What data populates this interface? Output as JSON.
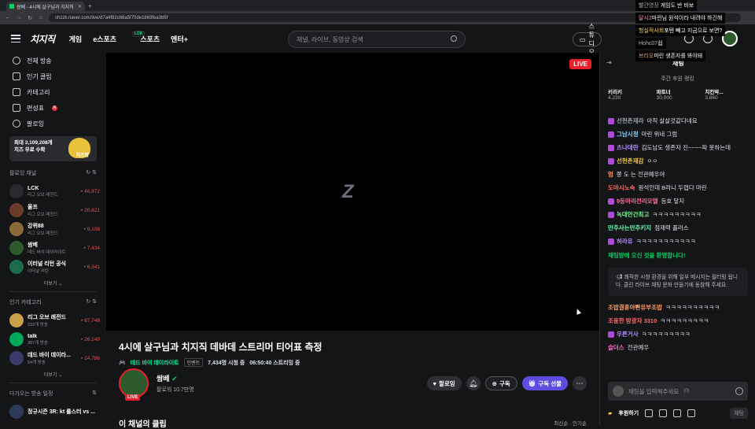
{
  "browser": {
    "tab_title": "쌈베 - 4시에 살구님과 치지직",
    "new_tab": "+",
    "url": "chzzk.naver.com/live/d7a4f82c66a5f70de1869fea3b5f"
  },
  "header": {
    "logo": "치지직",
    "nav": [
      "게임",
      "e스포츠",
      "스포츠",
      "엔터+"
    ],
    "lck_badge": "LCK",
    "search_placeholder": "채널, 라이브, 동영상 검색",
    "studio": "스튜디오"
  },
  "sidebar": {
    "menu": [
      {
        "label": "전체 방송",
        "icon": "broadcast-icon"
      },
      {
        "label": "인기 클립",
        "icon": "scissors-icon"
      },
      {
        "label": "카테고리",
        "icon": "grid-icon"
      },
      {
        "label": "편성표",
        "icon": "calendar-icon",
        "new": "N"
      },
      {
        "label": "팔로잉",
        "icon": "heart-icon"
      }
    ],
    "promo": {
      "line1": "최대 3,109,208개",
      "line2": "치즈 무료 수확",
      "tag": "치즈팜"
    },
    "following_header": "팔로잉 채널",
    "following": [
      {
        "name": "LCK",
        "sub": "리그 오브 레전드",
        "count": "46,972",
        "color": "#2a2b2f"
      },
      {
        "name": "울프",
        "sub": "리그 오브 레전드",
        "count": "20,621",
        "color": "#6b3b2a"
      },
      {
        "name": "강퀴88",
        "sub": "리그 오브 레전드",
        "count": "9,108",
        "color": "#8a6a3a"
      },
      {
        "name": "쌈베",
        "sub": "데드 바이 데이라이트",
        "count": "7,434",
        "color": "#2c5a2c"
      },
      {
        "name": "이터널 리턴 공식",
        "sub": "이터널 리턴",
        "count": "6,341",
        "color": "#1c6b4a"
      }
    ],
    "more": "더보기",
    "popular_header": "인기 카테고리",
    "popular": [
      {
        "name": "리그 오브 레전드",
        "sub": "232개 방송",
        "count": "87,748",
        "color": "#c8a14a"
      },
      {
        "name": "talk",
        "sub": "387개 방송",
        "count": "26,149",
        "color": "#00a85a"
      },
      {
        "name": "데드 바이 데이라...",
        "sub": "54개 방송",
        "count": "24,786",
        "color": "#3a3a6b"
      }
    ],
    "more2": "더보기",
    "upcoming_header": "다가오는 방송 일정",
    "upcoming": {
      "name": "정규시즌 3R: kt 롤스터 vs ..."
    }
  },
  "player": {
    "live": "LIVE",
    "logo": "Z"
  },
  "stream": {
    "title": "4시에 살구님과 치지직 데바데 스트리머 티어표 측정",
    "category": "데드 바이 데이라이트",
    "tag": "인벤트",
    "viewers": "7,434명 시청 중",
    "uptime": "06:50:40 스트리밍 중",
    "streamer": "쌈베",
    "followers": "팔로워 10.7만명",
    "live": "LIVE",
    "follow": "팔로잉",
    "subscribe": "구독",
    "gift": "구독 선물",
    "clips": "이 채널의 클립",
    "sort": "최신순 · 인기순"
  },
  "chat": {
    "title": "채팅",
    "ranking_head": "주간 후원 랭킹",
    "ranking": [
      {
        "name": "키리키",
        "val": "4,230"
      },
      {
        "name": "파트너",
        "val": "30,000"
      },
      {
        "name": "치킨막...",
        "val": "3,860"
      }
    ],
    "messages": [
      {
        "nick": "선헌존재라",
        "text": "아직 살살것같다네요",
        "color": "#9ca0a8",
        "badge": true
      },
      {
        "nick": "그남시정",
        "text": "마린 위네 그럼",
        "color": "#8fd3ff",
        "badge": true
      },
      {
        "nick": "츠나데란",
        "text": "김도남도 생존자 진~~~~파 못하는데",
        "color": "#b58cff",
        "badge": true
      },
      {
        "nick": "선헌존재감",
        "text": "ㅇㅇ",
        "color": "#f2c94c",
        "badge": true
      },
      {
        "nick": "엄",
        "text": "쫑 도 는 전관예우야",
        "color": "#ff9f6b",
        "badge": false
      },
      {
        "nick": "도마시노속",
        "text": "원석인데 B라니 두렵다 마린",
        "color": "#ff6b6b",
        "badge": false
      },
      {
        "nick": "9등마리전리모델",
        "text": "등호 닿지",
        "color": "#ff6b9f",
        "badge": true
      },
      {
        "nick": "녹대안간최고",
        "text": "ㅋㅋㅋㅋㅋㅋㅋㅋㅋ",
        "color": "#6bff8f",
        "badge": true
      },
      {
        "nick": "만주사는만주키지",
        "text": "점재력 플러스",
        "color": "#6bffb8",
        "badge": false
      },
      {
        "nick": "허라유",
        "text": "ㅋㅋㅋㅋㅋㅋㅋㅋㅋㅋㅋ",
        "color": "#b58cff",
        "badge": true
      }
    ],
    "welcome": "채팅방에 오신 것을 환영합니다!",
    "notice": "쾌적한 시청 환경을 위해 일부 메시지는 필터링 됩니다. 클린 라이브 채팅 문화 만들기에 동참해 주세요.",
    "after": [
      {
        "nick": "조밥결훈아빤유부조밥",
        "text": "ㅋㅋㅋㅋㅋㅋㅋㅋㅋㅋ",
        "color": "#ff9f6b",
        "badge": false
      },
      {
        "nick": "조용한 방광자 3310",
        "text": "ㅋㅋㅋㅋㅋㅋㅋㅋㅋ",
        "color": "#ff6b6b",
        "badge": false
      },
      {
        "nick": "우른거사",
        "text": "ㅋㅋㅋㅋㅋㅋㅋㅋㅋ",
        "color": "#b58cff",
        "badge": true
      },
      {
        "nick": "슬더스",
        "text": "전관예우",
        "color": "#ff6bd0",
        "badge": false
      }
    ],
    "input_placeholder": "채팅을 입력해주세요",
    "input_count": "0",
    "donate": "후원하기",
    "send": "채팅"
  },
  "overlay": [
    {
      "nick": "달시2",
      "text": "마린님 원석이라 내려야 하긴해",
      "color": "#ff8fb8"
    },
    {
      "nick": "헝실적사회",
      "text": "포텐 빼고 지금으로 보면?",
      "color": "#ffd36b"
    },
    {
      "nick": "Hohc07",
      "text": "쉽",
      "color": "#bbb"
    },
    {
      "nick": "브리오",
      "text": "마린 생존자를 봐야돼",
      "color": "#ff9f6b"
    }
  ],
  "overlay_top": {
    "nick": "빨간영장",
    "text": "게임도 반 바보"
  }
}
